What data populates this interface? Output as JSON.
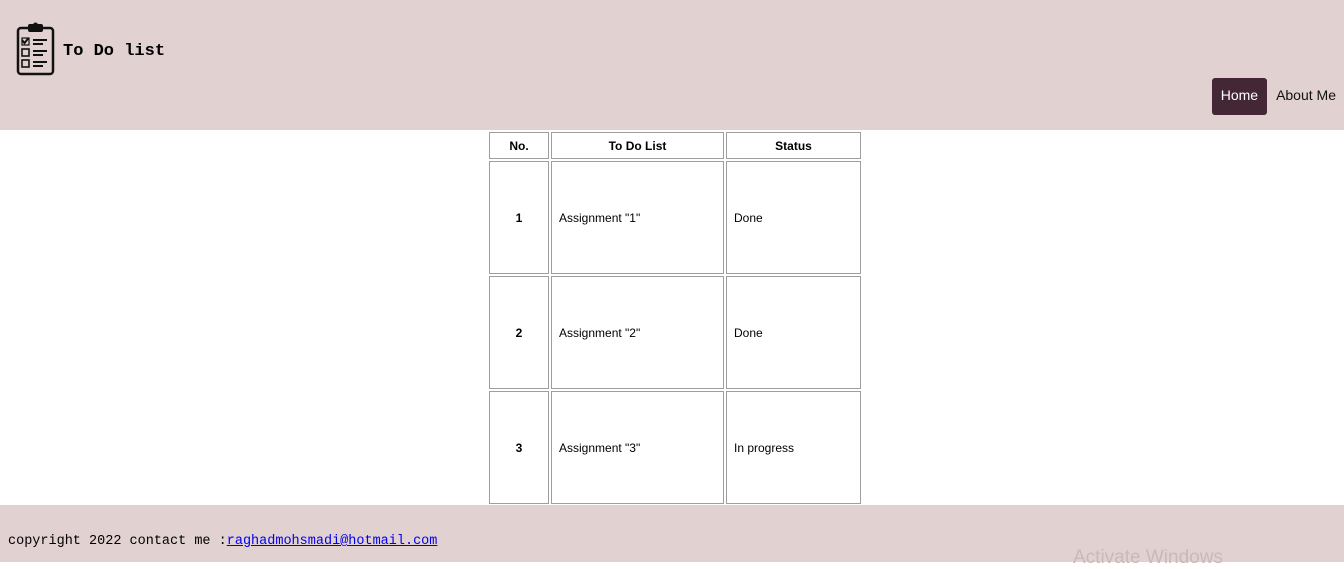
{
  "header": {
    "title": "To Do list",
    "logo_icon": "clipboard-checklist-icon"
  },
  "nav": {
    "items": [
      {
        "label": "Home",
        "active": true
      },
      {
        "label": "About Me",
        "active": false
      }
    ]
  },
  "table": {
    "headers": [
      "No.",
      "To Do List",
      "Status"
    ],
    "rows": [
      {
        "no": "1",
        "task": "Assignment \"1\"",
        "status": "Done"
      },
      {
        "no": "2",
        "task": "Assignment \"2\"",
        "status": "Done"
      },
      {
        "no": "3",
        "task": "Assignment \"3\"",
        "status": "In progress"
      }
    ]
  },
  "footer": {
    "text": "copyright 2022 contact me :",
    "email": "raghadmohsmadi@hotmail.com"
  },
  "overlay": {
    "watermark": "Activate Windows"
  },
  "colors": {
    "header_bg": "#e1d1d1",
    "nav_active_bg": "#432734",
    "link": "#0000ee"
  }
}
